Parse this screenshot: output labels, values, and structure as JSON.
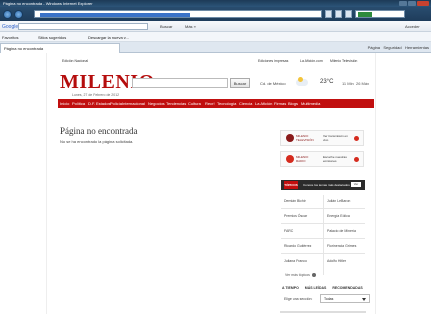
{
  "window": {
    "title": "Página no encontrada - Windows Internet Explorer"
  },
  "googlebar": {
    "label": "Google",
    "buscar": "Buscar",
    "mas": "Más »",
    "acceder": "Acceder"
  },
  "favbar": {
    "favoritos": "Favoritos",
    "sitios": "Sitios sugeridos",
    "galeria": "Descargar la nueva v..."
  },
  "tabbar": {
    "tab_title": "Página no encontrada",
    "pagina": "Página",
    "seguridad": "Seguridad",
    "herramientas": "Herramientas"
  },
  "site": {
    "edition": "Edición Nacional",
    "top_links": [
      "Ediciones impresas",
      "La Afición.com",
      "Milenio Televisión"
    ],
    "logo": "MILENIO",
    "dateline": "Lunes, 27 de Febrero de 2012",
    "search_button": "Buscar",
    "weather": {
      "city": "Cd. de México",
      "temp": "23°C",
      "mid": "11 Min",
      "max": "26 Máx"
    },
    "nav": [
      "Inicio",
      "Política",
      "D.F.",
      "Estados",
      "Policía",
      "Internacional",
      "Negocios",
      "Tendencias",
      "Cultura",
      "Recr!",
      "Tecnología",
      "Ciencia",
      "La Afición",
      "Firmas",
      "Blogs",
      "Multimedia"
    ]
  },
  "notfound": {
    "title": "Página no encontrada",
    "subtitle": "No se ha encontrado la página solicitada."
  },
  "sidebar": {
    "promo1": {
      "brand": "MILENIO TELEVISIÓN",
      "text": "Ver transmisión en vivo"
    },
    "promo2": {
      "brand": "MILENIO RADIO",
      "text": "Escuche nuestras emisiones"
    },
    "topics_badge": "TÓPICOS",
    "topics_text": "Conoce los temas más destacados",
    "topics_more": "Ver",
    "topics": [
      [
        "Demián Bichir",
        "Julián LeBaron"
      ],
      [
        "Premios Óscar",
        "Energía Eólica"
      ],
      [
        "FARC",
        "Palacio de Minería"
      ],
      [
        "Ricardo Gutiérrez",
        "Florinencia Grimes"
      ],
      [
        "Juliana Franco",
        "Adolfo Hitler"
      ]
    ],
    "more_topics": "Ver más tópicos",
    "bottom_tabs": [
      "A TIEMPO",
      "MÁS LEÍDAS",
      "RECOMENDADAS"
    ],
    "section_label": "Elige una sección:",
    "section_value": "Todas"
  },
  "colors": {
    "brand_red": "#c10f0f",
    "titlebar": "#1d3a57"
  }
}
